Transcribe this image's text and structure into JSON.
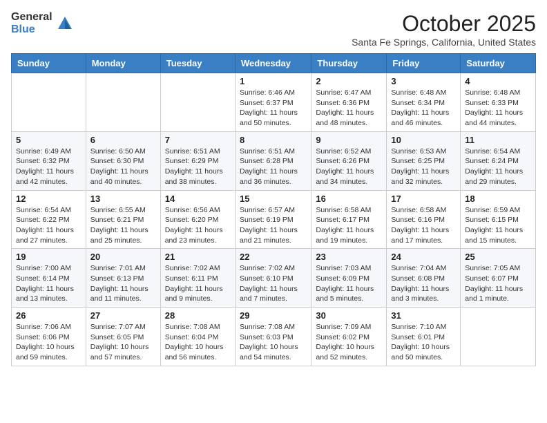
{
  "logo": {
    "general": "General",
    "blue": "Blue"
  },
  "header": {
    "month": "October 2025",
    "location": "Santa Fe Springs, California, United States"
  },
  "weekdays": [
    "Sunday",
    "Monday",
    "Tuesday",
    "Wednesday",
    "Thursday",
    "Friday",
    "Saturday"
  ],
  "weeks": [
    [
      {
        "day": "",
        "info": ""
      },
      {
        "day": "",
        "info": ""
      },
      {
        "day": "",
        "info": ""
      },
      {
        "day": "1",
        "info": "Sunrise: 6:46 AM\nSunset: 6:37 PM\nDaylight: 11 hours\nand 50 minutes."
      },
      {
        "day": "2",
        "info": "Sunrise: 6:47 AM\nSunset: 6:36 PM\nDaylight: 11 hours\nand 48 minutes."
      },
      {
        "day": "3",
        "info": "Sunrise: 6:48 AM\nSunset: 6:34 PM\nDaylight: 11 hours\nand 46 minutes."
      },
      {
        "day": "4",
        "info": "Sunrise: 6:48 AM\nSunset: 6:33 PM\nDaylight: 11 hours\nand 44 minutes."
      }
    ],
    [
      {
        "day": "5",
        "info": "Sunrise: 6:49 AM\nSunset: 6:32 PM\nDaylight: 11 hours\nand 42 minutes."
      },
      {
        "day": "6",
        "info": "Sunrise: 6:50 AM\nSunset: 6:30 PM\nDaylight: 11 hours\nand 40 minutes."
      },
      {
        "day": "7",
        "info": "Sunrise: 6:51 AM\nSunset: 6:29 PM\nDaylight: 11 hours\nand 38 minutes."
      },
      {
        "day": "8",
        "info": "Sunrise: 6:51 AM\nSunset: 6:28 PM\nDaylight: 11 hours\nand 36 minutes."
      },
      {
        "day": "9",
        "info": "Sunrise: 6:52 AM\nSunset: 6:26 PM\nDaylight: 11 hours\nand 34 minutes."
      },
      {
        "day": "10",
        "info": "Sunrise: 6:53 AM\nSunset: 6:25 PM\nDaylight: 11 hours\nand 32 minutes."
      },
      {
        "day": "11",
        "info": "Sunrise: 6:54 AM\nSunset: 6:24 PM\nDaylight: 11 hours\nand 29 minutes."
      }
    ],
    [
      {
        "day": "12",
        "info": "Sunrise: 6:54 AM\nSunset: 6:22 PM\nDaylight: 11 hours\nand 27 minutes."
      },
      {
        "day": "13",
        "info": "Sunrise: 6:55 AM\nSunset: 6:21 PM\nDaylight: 11 hours\nand 25 minutes."
      },
      {
        "day": "14",
        "info": "Sunrise: 6:56 AM\nSunset: 6:20 PM\nDaylight: 11 hours\nand 23 minutes."
      },
      {
        "day": "15",
        "info": "Sunrise: 6:57 AM\nSunset: 6:19 PM\nDaylight: 11 hours\nand 21 minutes."
      },
      {
        "day": "16",
        "info": "Sunrise: 6:58 AM\nSunset: 6:17 PM\nDaylight: 11 hours\nand 19 minutes."
      },
      {
        "day": "17",
        "info": "Sunrise: 6:58 AM\nSunset: 6:16 PM\nDaylight: 11 hours\nand 17 minutes."
      },
      {
        "day": "18",
        "info": "Sunrise: 6:59 AM\nSunset: 6:15 PM\nDaylight: 11 hours\nand 15 minutes."
      }
    ],
    [
      {
        "day": "19",
        "info": "Sunrise: 7:00 AM\nSunset: 6:14 PM\nDaylight: 11 hours\nand 13 minutes."
      },
      {
        "day": "20",
        "info": "Sunrise: 7:01 AM\nSunset: 6:13 PM\nDaylight: 11 hours\nand 11 minutes."
      },
      {
        "day": "21",
        "info": "Sunrise: 7:02 AM\nSunset: 6:11 PM\nDaylight: 11 hours\nand 9 minutes."
      },
      {
        "day": "22",
        "info": "Sunrise: 7:02 AM\nSunset: 6:10 PM\nDaylight: 11 hours\nand 7 minutes."
      },
      {
        "day": "23",
        "info": "Sunrise: 7:03 AM\nSunset: 6:09 PM\nDaylight: 11 hours\nand 5 minutes."
      },
      {
        "day": "24",
        "info": "Sunrise: 7:04 AM\nSunset: 6:08 PM\nDaylight: 11 hours\nand 3 minutes."
      },
      {
        "day": "25",
        "info": "Sunrise: 7:05 AM\nSunset: 6:07 PM\nDaylight: 11 hours\nand 1 minute."
      }
    ],
    [
      {
        "day": "26",
        "info": "Sunrise: 7:06 AM\nSunset: 6:06 PM\nDaylight: 10 hours\nand 59 minutes."
      },
      {
        "day": "27",
        "info": "Sunrise: 7:07 AM\nSunset: 6:05 PM\nDaylight: 10 hours\nand 57 minutes."
      },
      {
        "day": "28",
        "info": "Sunrise: 7:08 AM\nSunset: 6:04 PM\nDaylight: 10 hours\nand 56 minutes."
      },
      {
        "day": "29",
        "info": "Sunrise: 7:08 AM\nSunset: 6:03 PM\nDaylight: 10 hours\nand 54 minutes."
      },
      {
        "day": "30",
        "info": "Sunrise: 7:09 AM\nSunset: 6:02 PM\nDaylight: 10 hours\nand 52 minutes."
      },
      {
        "day": "31",
        "info": "Sunrise: 7:10 AM\nSunset: 6:01 PM\nDaylight: 10 hours\nand 50 minutes."
      },
      {
        "day": "",
        "info": ""
      }
    ]
  ]
}
